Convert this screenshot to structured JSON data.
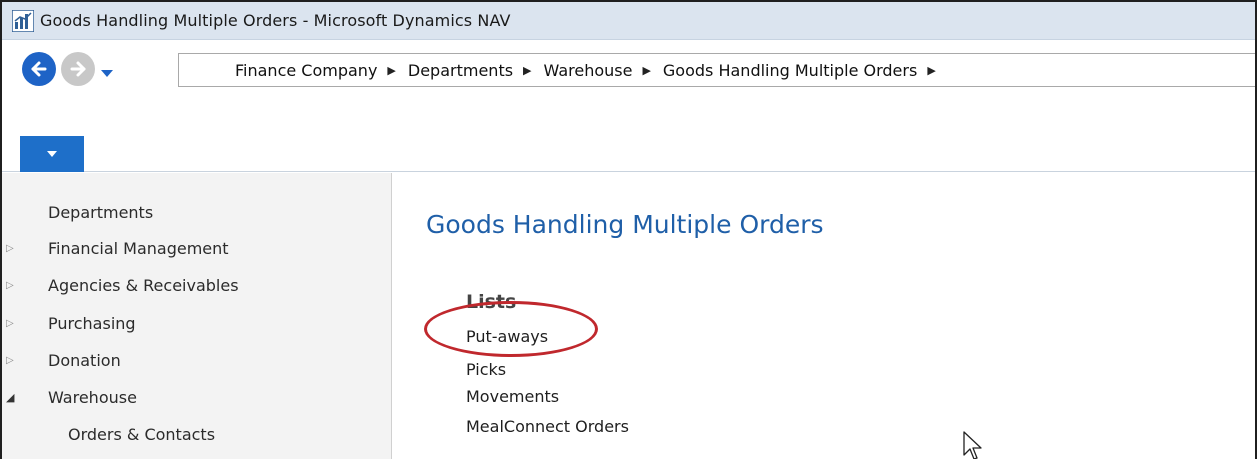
{
  "window": {
    "title": "Goods Handling Multiple Orders - Microsoft Dynamics NAV"
  },
  "breadcrumb": [
    "Finance Company",
    "Departments",
    "Warehouse",
    "Goods Handling Multiple Orders"
  ],
  "breadcrumb_separator": "▶",
  "navigation": {
    "items": [
      {
        "label": "Departments",
        "expander": ""
      },
      {
        "label": "Financial Management",
        "expander": "▷"
      },
      {
        "label": "Agencies & Receivables",
        "expander": "▷"
      },
      {
        "label": "Purchasing",
        "expander": "▷"
      },
      {
        "label": "Donation",
        "expander": "▷"
      },
      {
        "label": "Warehouse",
        "expander": "◢"
      },
      {
        "label": "Orders & Contacts",
        "expander": ""
      }
    ]
  },
  "content": {
    "page_title": "Goods Handling Multiple Orders",
    "section_title": "Lists",
    "links": [
      "Put-aways",
      "Picks",
      "Movements",
      "MealConnect Orders"
    ]
  },
  "colors": {
    "accent": "#1e63c6",
    "title_blue": "#1f5fa8",
    "highlight_red": "#c0282d"
  }
}
